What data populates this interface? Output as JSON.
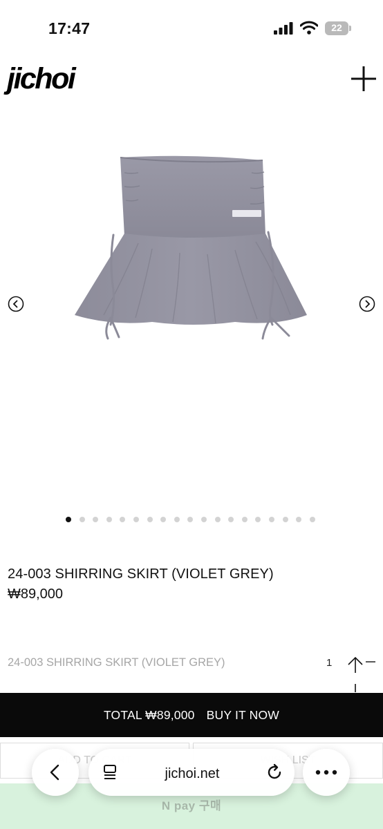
{
  "status_bar": {
    "time": "17:47",
    "battery_level": "22",
    "icons": [
      "signal-icon",
      "wifi-icon",
      "battery-icon"
    ]
  },
  "header": {
    "logo": "jichoi",
    "menu_icon": "plus-icon"
  },
  "gallery": {
    "image": "violet-grey-shirring-skirt",
    "image_color": "#8f8e9c",
    "dot_count": 19,
    "active_dot": 1,
    "prev_icon": "chevron-left-circle-icon",
    "next_icon": "chevron-right-circle-icon"
  },
  "product": {
    "title": "24-003 SHIRRING SKIRT (VIOLET GREY)",
    "price": "₩89,000"
  },
  "option": {
    "name": "24-003 SHIRRING SKIRT (VIOLET GREY)",
    "quantity": "1",
    "up_icon": "arrow-up-icon",
    "down_icon": "minus-icon"
  },
  "purchase": {
    "total_label": "TOTAL ₩89,000",
    "buy_now_label": "BUY IT NOW"
  },
  "secondary_buttons": {
    "left_label": "ADD TO CART",
    "right_label": "WISH LIST"
  },
  "pay": {
    "label": "N pay 구매",
    "color": "#d8f2dd"
  },
  "browser": {
    "url": "jichoi.net",
    "back_icon": "chevron-left-icon",
    "tabs_icon": "tabs-icon",
    "reload_icon": "reload-icon",
    "more_icon": "more-icon"
  }
}
